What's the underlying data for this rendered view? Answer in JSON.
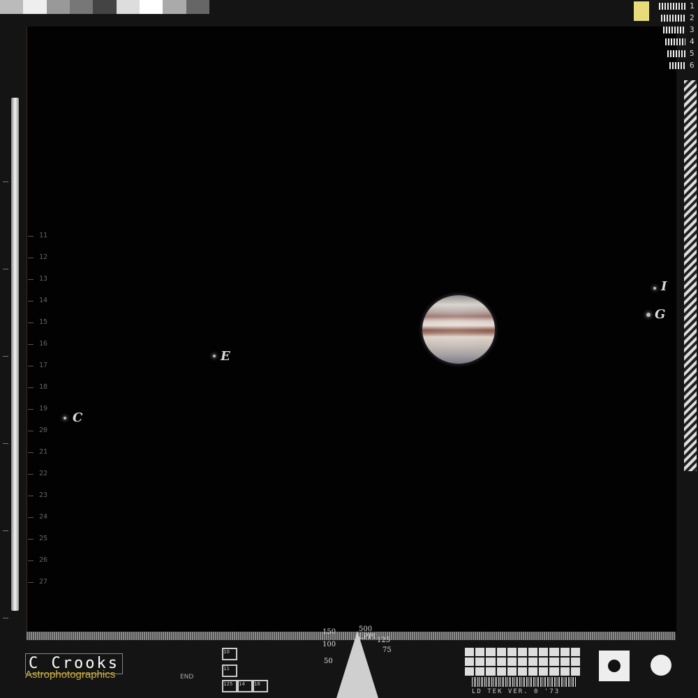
{
  "scale": {
    "labels": [
      "11",
      "12",
      "13",
      "14",
      "15",
      "16",
      "17",
      "18",
      "19",
      "20",
      "21",
      "22",
      "23",
      "24",
      "25",
      "26",
      "27"
    ]
  },
  "moons": [
    {
      "label": "I"
    },
    {
      "label": "G"
    },
    {
      "label": "E"
    },
    {
      "label": "C"
    }
  ],
  "resolution": {
    "numbers": [
      "1",
      "2",
      "3",
      "4",
      "5",
      "6"
    ]
  },
  "target": {
    "lppi": "500 LPPI",
    "n150": "150",
    "n100": "100",
    "n125": "125",
    "n75": "75",
    "n50": "50"
  },
  "logo": {
    "name": "C Crooks",
    "sub": "Astrophotographics"
  },
  "footer": {
    "end": "END",
    "version": "LD TEK VER. 0 '73",
    "mini": [
      "10",
      "11",
      "125",
      "14",
      "16"
    ]
  },
  "colors": {
    "logo_sub": "#d4b43a",
    "yellow_block": "#e8dc7a"
  }
}
